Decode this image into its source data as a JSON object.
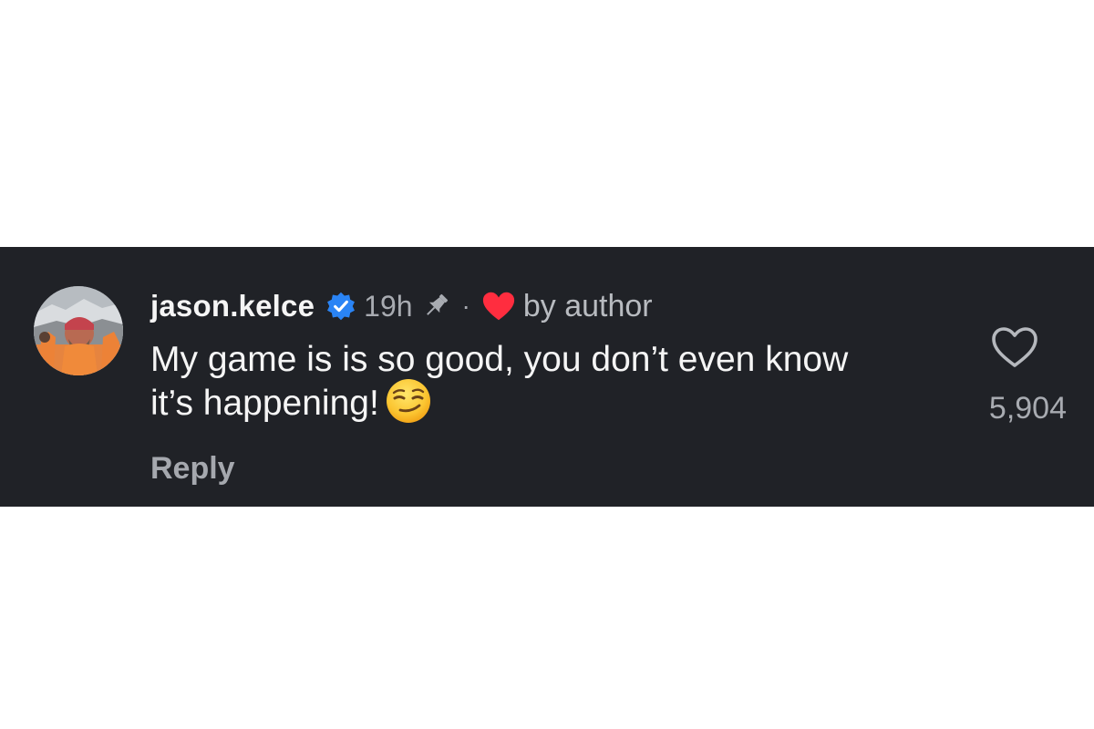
{
  "comment": {
    "username": "jason.kelce",
    "verified_icon": "verified-badge-icon",
    "timestamp": "19h",
    "pin_icon": "pin-icon",
    "separator": "·",
    "author_heart_icon": "heart-filled-icon",
    "author_like_label": "by author",
    "text": "My game is is so good, you don’t even know it’s happening!",
    "emoji": "smirking-face-emoji",
    "reply_label": "Reply",
    "like_icon": "heart-outline-icon",
    "like_count": "5,904"
  },
  "colors": {
    "background": "#202227",
    "primary_text": "#f5f5f5",
    "secondary_text": "#a8abb1",
    "verified_blue": "#2a84f5",
    "heart_red": "#ff2d3f"
  }
}
